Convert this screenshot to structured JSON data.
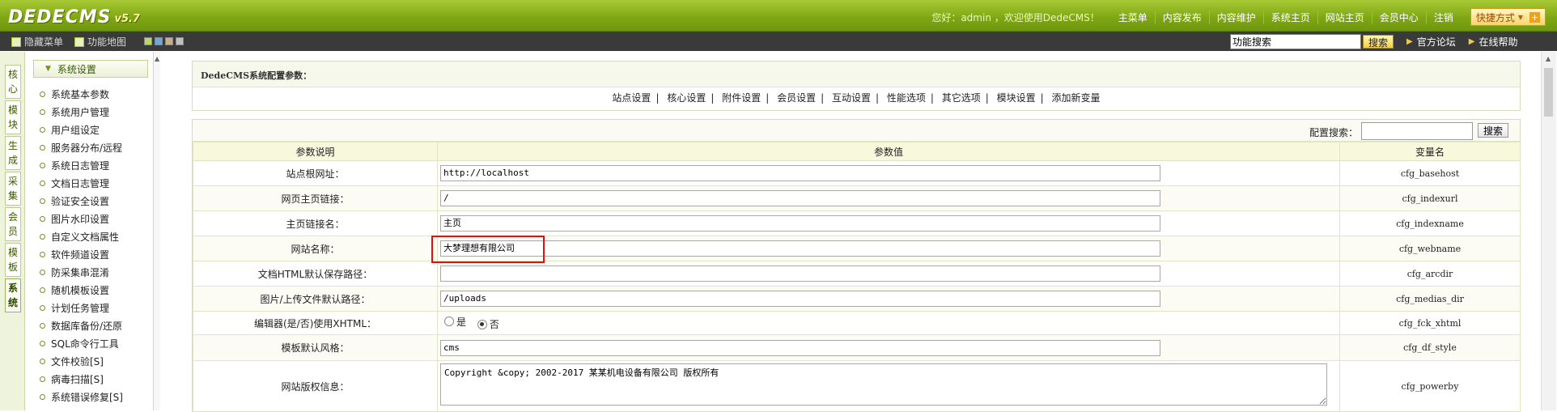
{
  "brand": {
    "logo": "DEDECMS",
    "version": "v5.7"
  },
  "topnav": {
    "welcome": "您好：admin ，欢迎使用DedeCMS！",
    "links": [
      "主菜单",
      "内容发布",
      "内容维护",
      "系统主页",
      "网站主页",
      "会员中心",
      "注销"
    ],
    "quick": "快捷方式",
    "quick_arrow": "▼",
    "quick_plus": "+"
  },
  "toolbar": {
    "hide_menu": "隐藏菜单",
    "func_map": "功能地图",
    "swatches": [
      "#b9d66b",
      "#6fa7d8",
      "#c8b08a",
      "#c0c0c0"
    ],
    "search_value": "功能搜索",
    "search_btn": "搜索",
    "forum": "官方论坛",
    "help": "在线帮助"
  },
  "vtabs": [
    "核心",
    "模块",
    "生成",
    "采集",
    "会员",
    "模板",
    "系统"
  ],
  "menu": {
    "head": "系统设置",
    "items": [
      "系统基本参数",
      "系统用户管理",
      "用户组设定",
      "服务器分布/远程",
      "系统日志管理",
      "文档日志管理",
      "验证安全设置",
      "图片水印设置",
      "自定义文档属性",
      "软件频道设置",
      "防采集串混淆",
      "随机模板设置",
      "计划任务管理",
      "数据库备份/还原",
      "SQL命令行工具",
      "文件校验[S]",
      "病毒扫描[S]",
      "系统错误修复[S]"
    ]
  },
  "config": {
    "title": "DedeCMS系统配置参数：",
    "tabs": [
      "站点设置",
      "核心设置",
      "附件设置",
      "会员设置",
      "互动设置",
      "性能选项",
      "其它选项",
      "模块设置",
      "添加新变量"
    ],
    "search_label": "配置搜索：",
    "search_btn": "搜索",
    "headers": [
      "参数说明",
      "参数值",
      "变量名"
    ],
    "rows": [
      {
        "label": "站点根网址：",
        "value": "http://localhost",
        "var": "cfg_basehost"
      },
      {
        "label": "网页主页链接：",
        "value": "/",
        "var": "cfg_indexurl"
      },
      {
        "label": "主页链接名：",
        "value": "主页",
        "var": "cfg_indexname"
      },
      {
        "label": "网站名称：",
        "value": "大梦理想有限公司",
        "var": "cfg_webname"
      },
      {
        "label": "文档HTML默认保存路径：",
        "value": "",
        "var": "cfg_arcdir"
      },
      {
        "label": "图片/上传文件默认路径：",
        "value": "/uploads",
        "var": "cfg_medias_dir"
      },
      {
        "label": "编辑器(是/否)使用XHTML：",
        "radio_yes": "是",
        "radio_no": "否",
        "var": "cfg_fck_xhtml"
      },
      {
        "label": "模板默认风格：",
        "value": "cms",
        "var": "cfg_df_style"
      },
      {
        "label": "网站版权信息：",
        "value": "Copyright &copy; 2002-2017 某某机电设备有限公司 版权所有",
        "var": "cfg_powerby"
      }
    ]
  },
  "colors": {
    "accent": "#7ea613",
    "highlight": "#e01010"
  }
}
